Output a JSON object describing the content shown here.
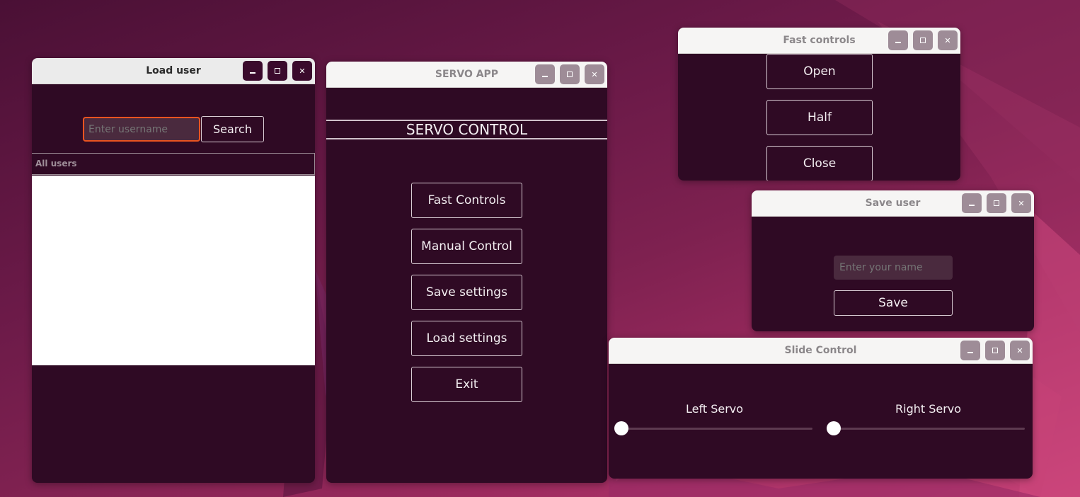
{
  "load_user_window": {
    "title": "Load user",
    "search_placeholder": "Enter username",
    "search_button": "Search",
    "list_header": "All users",
    "users": []
  },
  "servo_app_window": {
    "title": "SERVO APP",
    "heading": "SERVO CONTROL",
    "buttons": [
      "Fast Controls",
      "Manual Control",
      "Save settings",
      "Load settings",
      "Exit"
    ]
  },
  "fast_controls_window": {
    "title": "Fast controls",
    "buttons": [
      "Open",
      "Half",
      "Close"
    ]
  },
  "save_user_window": {
    "title": "Save user",
    "name_placeholder": "Enter your name",
    "save_button": "Save"
  },
  "slide_control_window": {
    "title": "Slide Control",
    "left_label": "Left Servo",
    "right_label": "Right Servo",
    "left_value": 0,
    "right_value": 0
  },
  "window_controls": {
    "minimize_glyph": "_",
    "close_glyph": "✕"
  },
  "colors": {
    "window_bg": "#2f0a24",
    "accent_focus": "#e95420",
    "desktop": "#7e2150"
  }
}
